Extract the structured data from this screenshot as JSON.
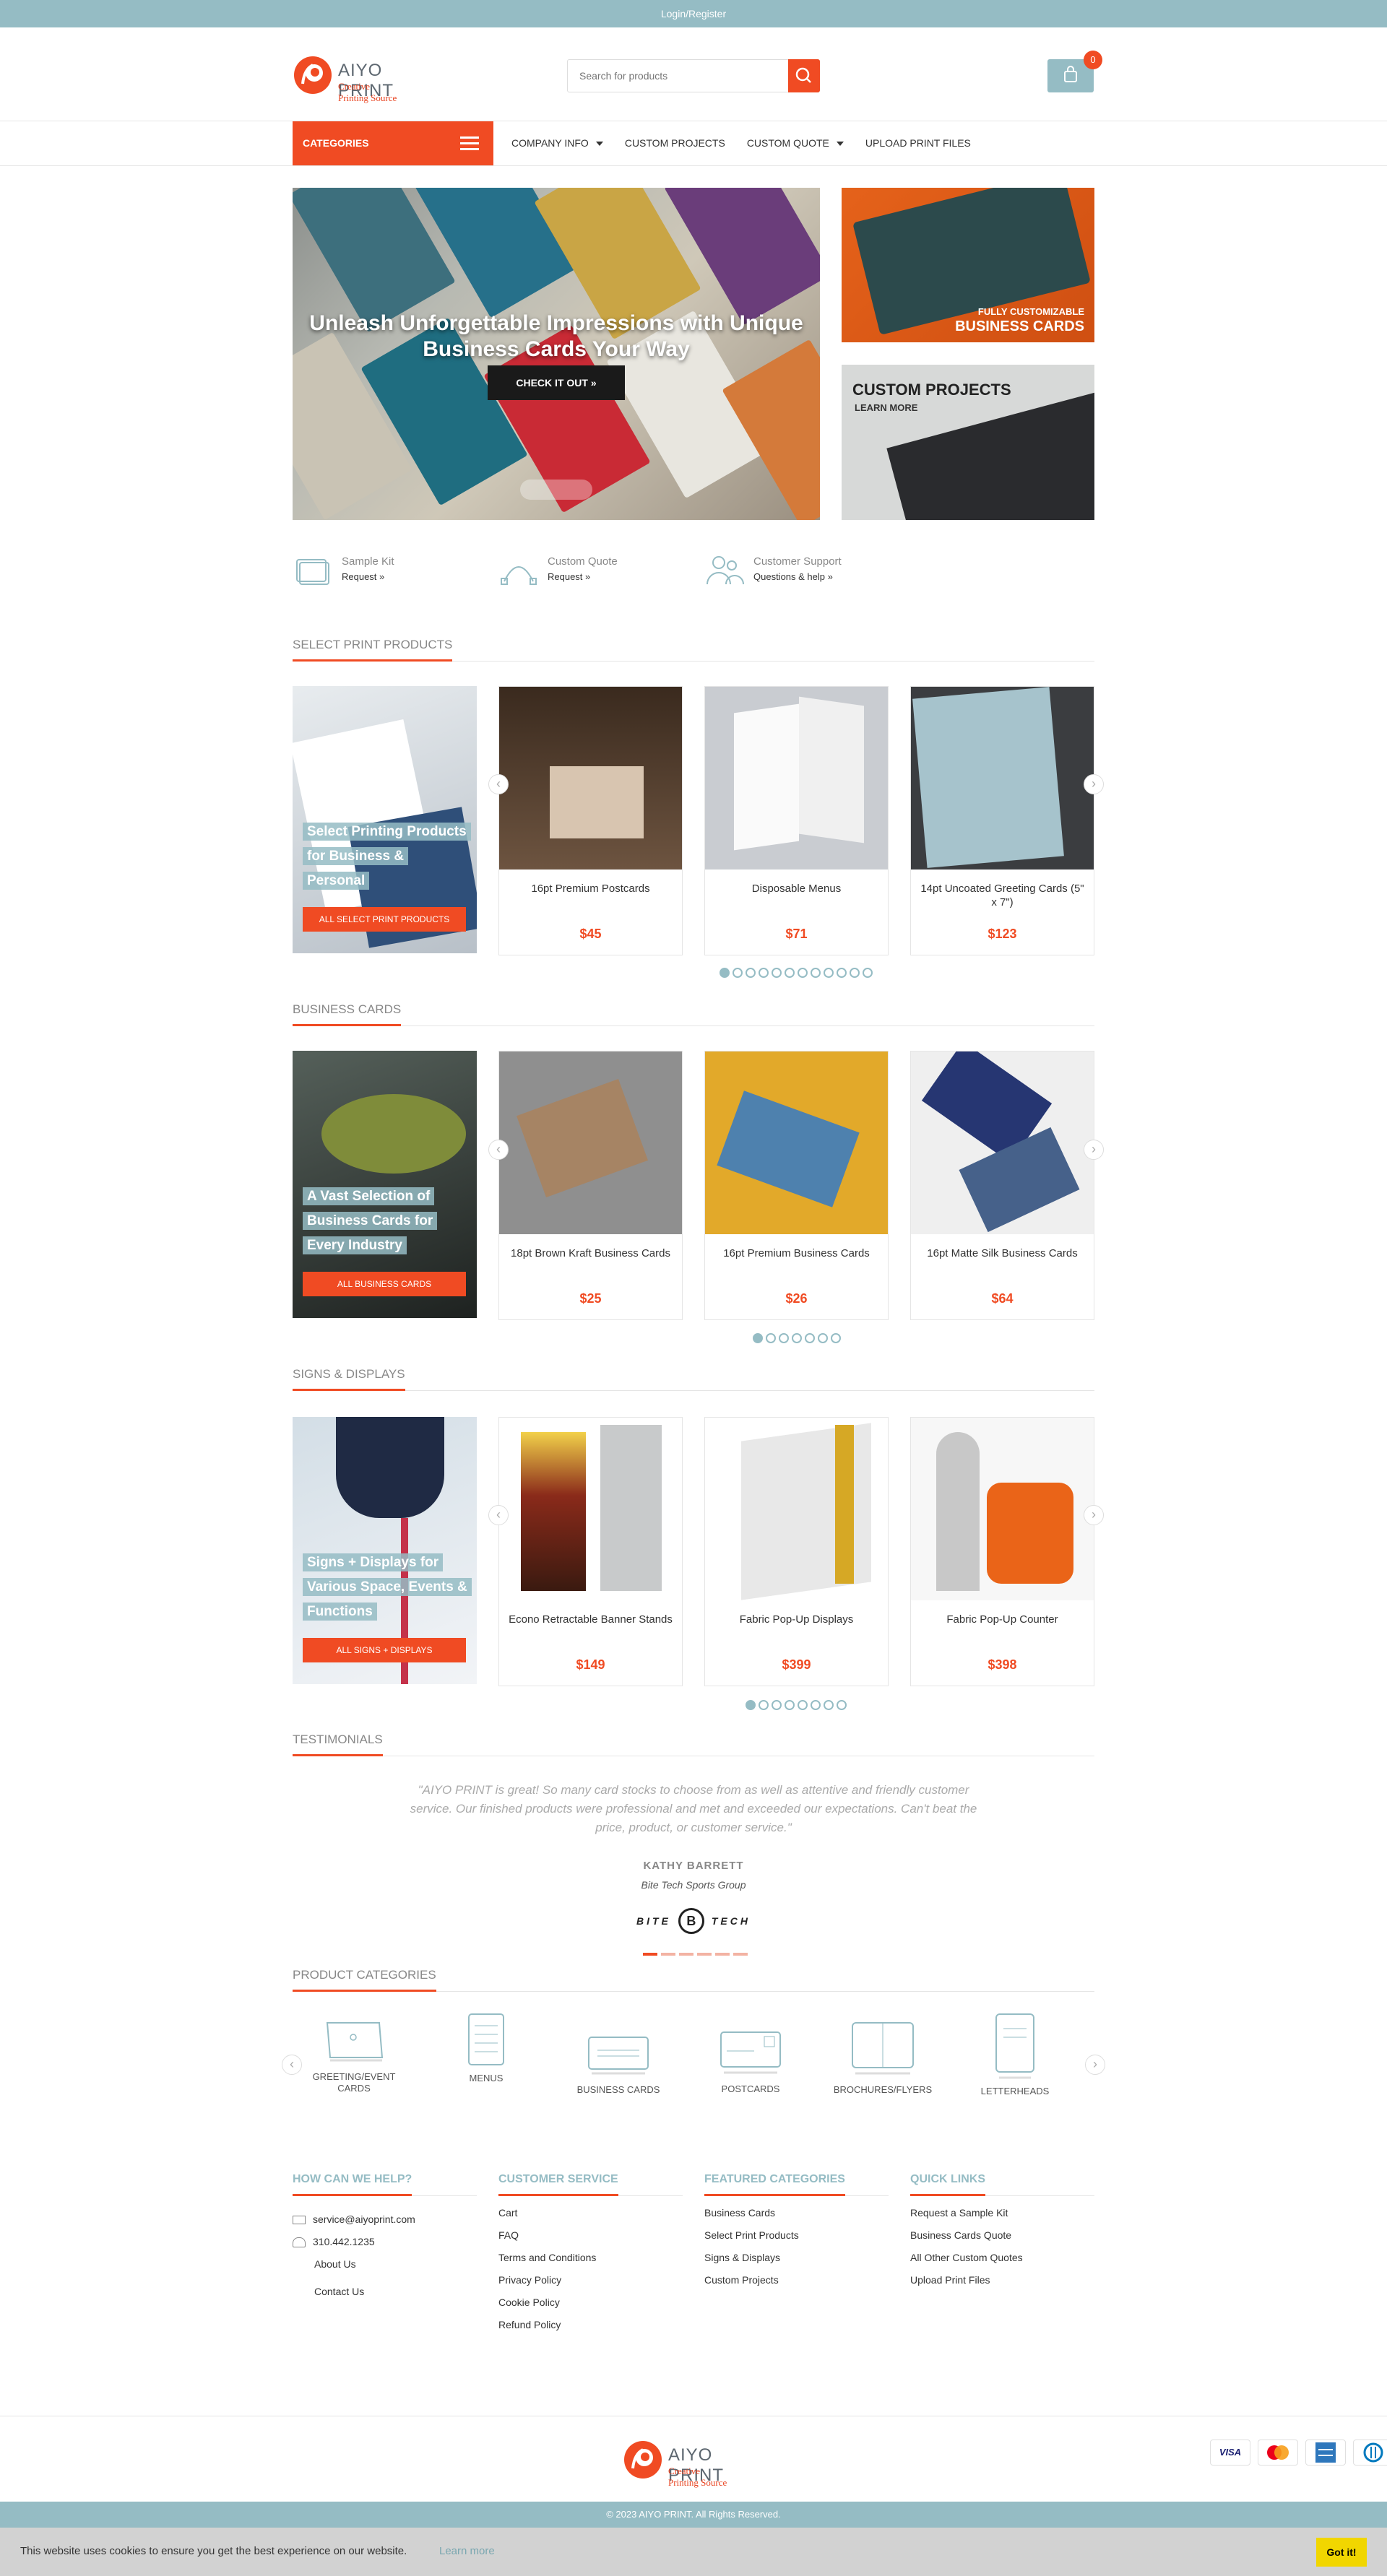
{
  "topbar": {
    "login": "Login/Register"
  },
  "brand": {
    "name": "AIYO PRINT",
    "tagline": "Creative Printing Source"
  },
  "search": {
    "placeholder": "Search for products"
  },
  "cart": {
    "count": "0"
  },
  "nav": {
    "categories": "CATEGORIES",
    "items": [
      "COMPANY INFO",
      "CUSTOM PROJECTS",
      "CUSTOM QUOTE",
      "UPLOAD PRINT FILES"
    ]
  },
  "hero": {
    "title": "Unleash Unforgettable Impressions with Unique Business Cards Your Way",
    "cta": "CHECK IT OUT »",
    "side1_line1": "FULLY CUSTOMIZABLE",
    "side1_line2": "BUSINESS CARDS",
    "side2_title": "CUSTOM PROJECTS",
    "side2_sub": "LEARN MORE"
  },
  "features": [
    {
      "title": "Sample Kit",
      "sub": "Request »"
    },
    {
      "title": "Custom Quote",
      "sub": "Request »"
    },
    {
      "title": "Customer Support",
      "sub": "Questions & help »"
    }
  ],
  "sections": {
    "select": {
      "title": "SELECT PRINT PRODUCTS",
      "banner": "Select Printing Products for Business & Personal",
      "banner_btn": "ALL SELECT PRINT PRODUCTS",
      "products": [
        {
          "name": "16pt Premium Postcards",
          "price": "$45"
        },
        {
          "name": "Disposable Menus",
          "price": "$71"
        },
        {
          "name": "14pt Uncoated Greeting Cards (5\" x 7\")",
          "price": "$123"
        }
      ],
      "dots": 12
    },
    "business": {
      "title": "BUSINESS CARDS",
      "banner": "A Vast Selection of Business Cards for Every Industry",
      "banner_btn": "ALL BUSINESS CARDS",
      "products": [
        {
          "name": "18pt Brown Kraft Business Cards",
          "price": "$25"
        },
        {
          "name": "16pt Premium Business Cards",
          "price": "$26"
        },
        {
          "name": "16pt Matte Silk Business Cards",
          "price": "$64"
        }
      ],
      "dots": 7
    },
    "signs": {
      "title": "SIGNS & DISPLAYS",
      "banner": "Signs + Displays for Various Space, Events & Functions",
      "banner_btn": "ALL SIGNS + DISPLAYS",
      "products": [
        {
          "name": "Econo Retractable Banner Stands",
          "price": "$149"
        },
        {
          "name": "Fabric Pop-Up Displays",
          "price": "$399"
        },
        {
          "name": "Fabric Pop-Up Counter",
          "price": "$398"
        }
      ],
      "dots": 8
    }
  },
  "testimonials": {
    "title": "TESTIMONIALS",
    "quote": "\"AIYO PRINT is great! So many card stocks to choose from as well as attentive and friendly customer service. Our finished products were professional and met and exceeded our expectations. Can't beat the price, product, or customer service.\"",
    "name": "KATHY BARRETT",
    "company": "Bite Tech Sports Group",
    "logo_left": "BITE",
    "logo_mid": "B",
    "logo_right": "TECH"
  },
  "product_categories": {
    "title": "PRODUCT CATEGORIES",
    "items": [
      "GREETING/EVENT CARDS",
      "MENUS",
      "BUSINESS CARDS",
      "POSTCARDS",
      "BROCHURES/FLYERS",
      "LETTERHEADS"
    ]
  },
  "footer": {
    "help": {
      "title": "HOW CAN WE HELP?",
      "email": "service@aiyoprint.com",
      "phone": "310.442.1235",
      "links": [
        "About Us",
        "Contact Us"
      ]
    },
    "service": {
      "title": "CUSTOMER SERVICE",
      "links": [
        "Cart",
        "FAQ",
        "Terms and Conditions",
        "Privacy Policy",
        "Cookie Policy",
        "Refund Policy"
      ]
    },
    "featured": {
      "title": "FEATURED CATEGORIES",
      "links": [
        "Business Cards",
        "Select Print Products",
        "Signs & Displays",
        "Custom Projects"
      ]
    },
    "quick": {
      "title": "QUICK LINKS",
      "links": [
        "Request a Sample Kit",
        "Business Cards Quote",
        "All Other Custom Quotes",
        "Upload Print Files"
      ]
    },
    "payments": [
      "VISA",
      "MC",
      "AMEX",
      "DINERS"
    ],
    "copyright": "© 2023 AIYO PRINT. All Rights Reserved."
  },
  "cookie": {
    "text": "This website uses cookies to ensure you get the best experience on our website.",
    "learn": "Learn more",
    "button": "Got it!"
  },
  "colors": {
    "accent": "#f04b23",
    "teal": "#95bcc4"
  }
}
